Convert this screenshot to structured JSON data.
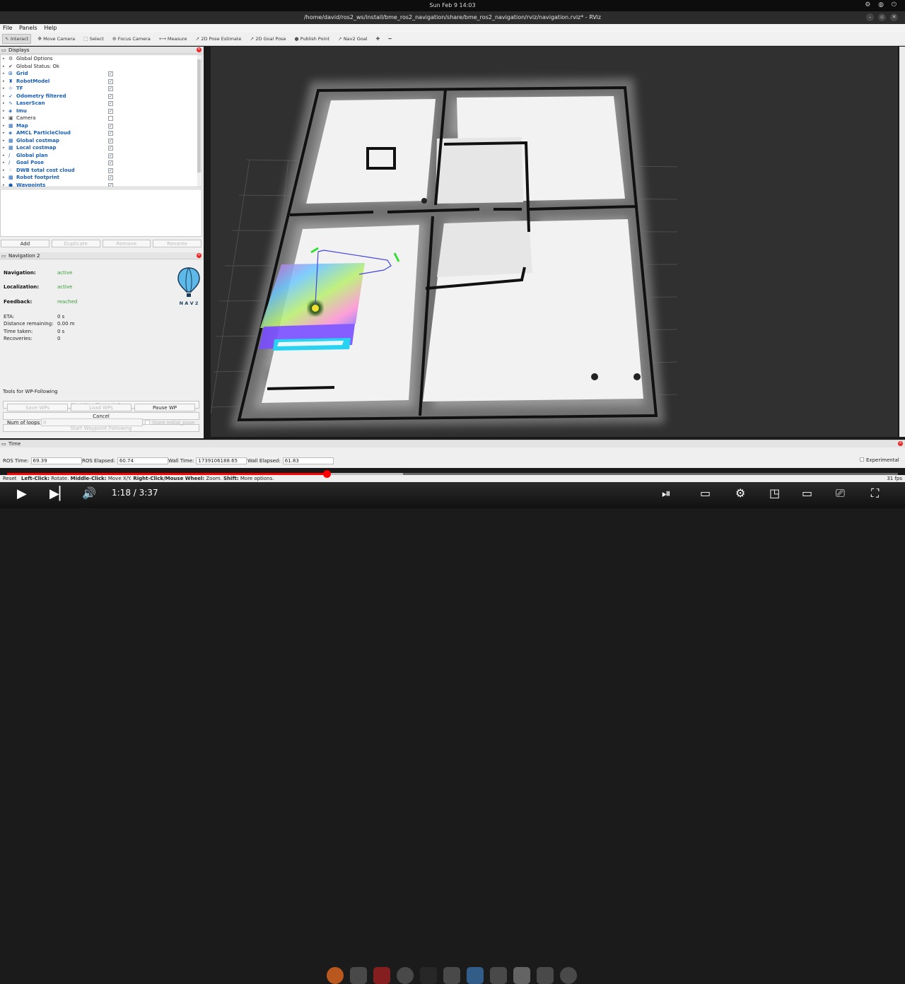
{
  "system": {
    "clock": "Sun Feb 9  14:03",
    "tray": "⚙ ◍ ⏻"
  },
  "window": {
    "title": "/home/david/ros2_ws/install/bme_ros2_navigation/share/bme_ros2_navigation/rviz/navigation.rviz* - RViz"
  },
  "menu": [
    "File",
    "Panels",
    "Help"
  ],
  "toolbar": [
    {
      "label": "Interact",
      "icon": "cursor-icon",
      "glyph": "⇖",
      "active": true
    },
    {
      "label": "Move Camera",
      "icon": "move-camera-icon",
      "glyph": "✥"
    },
    {
      "label": "Select",
      "icon": "select-icon",
      "glyph": "⬚"
    },
    {
      "label": "Focus Camera",
      "icon": "focus-camera-icon",
      "glyph": "⊕"
    },
    {
      "label": "Measure",
      "icon": "measure-icon",
      "glyph": "⟷"
    },
    {
      "label": "2D Pose Estimate",
      "icon": "pose-estimate-icon",
      "glyph": "➚"
    },
    {
      "label": "2D Goal Pose",
      "icon": "goal-pose-icon",
      "glyph": "➚"
    },
    {
      "label": "Publish Point",
      "icon": "publish-point-icon",
      "glyph": "●"
    },
    {
      "label": "Nav2 Goal",
      "icon": "nav2-goal-icon",
      "glyph": "➚"
    },
    {
      "label": "",
      "icon": "add-tool-icon",
      "glyph": "✚"
    },
    {
      "label": "",
      "icon": "remove-tool-icon",
      "glyph": "━"
    }
  ],
  "displays": {
    "header": "Displays",
    "items": [
      {
        "label": "Global Options",
        "icon": "gear-icon",
        "glyph": "⚙",
        "blue": false,
        "checked": null
      },
      {
        "label": "Global Status: Ok",
        "icon": "check-icon",
        "glyph": "✔",
        "blue": false,
        "checked": null
      },
      {
        "label": "Grid",
        "icon": "grid-icon",
        "glyph": "⊞",
        "blue": true,
        "checked": true
      },
      {
        "label": "RobotModel",
        "icon": "robot-icon",
        "glyph": "♜",
        "blue": true,
        "checked": true
      },
      {
        "label": "TF",
        "icon": "tf-icon",
        "glyph": "⊹",
        "blue": true,
        "checked": true
      },
      {
        "label": "Odometry filtered",
        "icon": "odometry-icon",
        "glyph": "➶",
        "blue": true,
        "checked": true
      },
      {
        "label": "LaserScan",
        "icon": "laserscan-icon",
        "glyph": "∿",
        "blue": true,
        "checked": true
      },
      {
        "label": "Imu",
        "icon": "imu-icon",
        "glyph": "◈",
        "blue": true,
        "checked": true
      },
      {
        "label": "Camera",
        "icon": "camera-icon",
        "glyph": "▣",
        "blue": false,
        "checked": false
      },
      {
        "label": "Map",
        "icon": "map-icon",
        "glyph": "▦",
        "blue": true,
        "checked": true
      },
      {
        "label": "AMCL ParticleCloud",
        "icon": "particlecloud-icon",
        "glyph": "◈",
        "blue": true,
        "checked": true
      },
      {
        "label": "Global costmap",
        "icon": "costmap-icon",
        "glyph": "▦",
        "blue": true,
        "checked": true
      },
      {
        "label": "Local costmap",
        "icon": "costmap-icon",
        "glyph": "▦",
        "blue": true,
        "checked": true
      },
      {
        "label": "Global plan",
        "icon": "path-icon",
        "glyph": "∕",
        "blue": true,
        "checked": true
      },
      {
        "label": "Goal Pose",
        "icon": "pose-icon",
        "glyph": "∕",
        "blue": true,
        "checked": true
      },
      {
        "label": "DWB total cost cloud",
        "icon": "pointcloud-icon",
        "glyph": "⁘",
        "blue": true,
        "checked": true
      },
      {
        "label": "Robot footprint",
        "icon": "footprint-icon",
        "glyph": "▩",
        "blue": true,
        "checked": true
      },
      {
        "label": "Waypoints",
        "icon": "waypoints-icon",
        "glyph": "●",
        "blue": true,
        "checked": true
      }
    ],
    "buttons": {
      "add": "Add",
      "duplicate": "Duplicate",
      "remove": "Remove",
      "rename": "Rename"
    }
  },
  "navigation": {
    "header": "Navigation 2",
    "navigation_label": "Navigation:",
    "navigation_value": "active",
    "localization_label": "Localization:",
    "localization_value": "active",
    "feedback_label": "Feedback:",
    "feedback_value": "reached",
    "eta_label": "ETA:",
    "eta_value": "0 s",
    "distance_label": "Distance remaining:",
    "distance_value": "0.00 m",
    "time_label": "Time taken:",
    "time_value": "0 s",
    "recoveries_label": "Recoveries:",
    "recoveries_value": "0",
    "logo_text": "N A V 2",
    "btn_nav_through_poses": "Start Nav Through Poses",
    "btn_cancel": "Cancel",
    "btn_waypoint": "Start Waypoint Following",
    "wp_tools_label": "Tools for WP-Following",
    "btn_save_wps": "Save WPs",
    "btn_load_wps": "Load WPs",
    "btn_pause_wp": "Pause WP",
    "loops_label": "Num of loops",
    "loops_value": "0",
    "store_initial_pose": "Store initial_pose"
  },
  "time_panel": {
    "header": "Time",
    "ros_time_label": "ROS Time:",
    "ros_time": "69.39",
    "ros_elapsed_label": "ROS Elapsed:",
    "ros_elapsed": "60.74",
    "wall_time_label": "Wall Time:",
    "wall_time": "1739106188.65",
    "wall_elapsed_label": "Wall Elapsed:",
    "wall_elapsed": "61.83",
    "experimental": "Experimental"
  },
  "status": {
    "reset": "Reset",
    "hint_left": "Left-Click:",
    "hint_left_v": " Rotate. ",
    "hint_mid": "Middle-Click:",
    "hint_mid_v": " Move X/Y. ",
    "hint_right": "Right-Click/Mouse Wheel:",
    "hint_right_v": " Zoom. ",
    "hint_shift": "Shift:",
    "hint_shift_v": " More options.",
    "fps": "31 fps"
  },
  "video": {
    "current": "1:18",
    "duration": "3:37",
    "progress": 0.359,
    "sep": " / "
  },
  "colors": {
    "accent_blue": "#1a5fb4",
    "active_green": "#3a9a3a",
    "progress_red": "#ff0000"
  }
}
